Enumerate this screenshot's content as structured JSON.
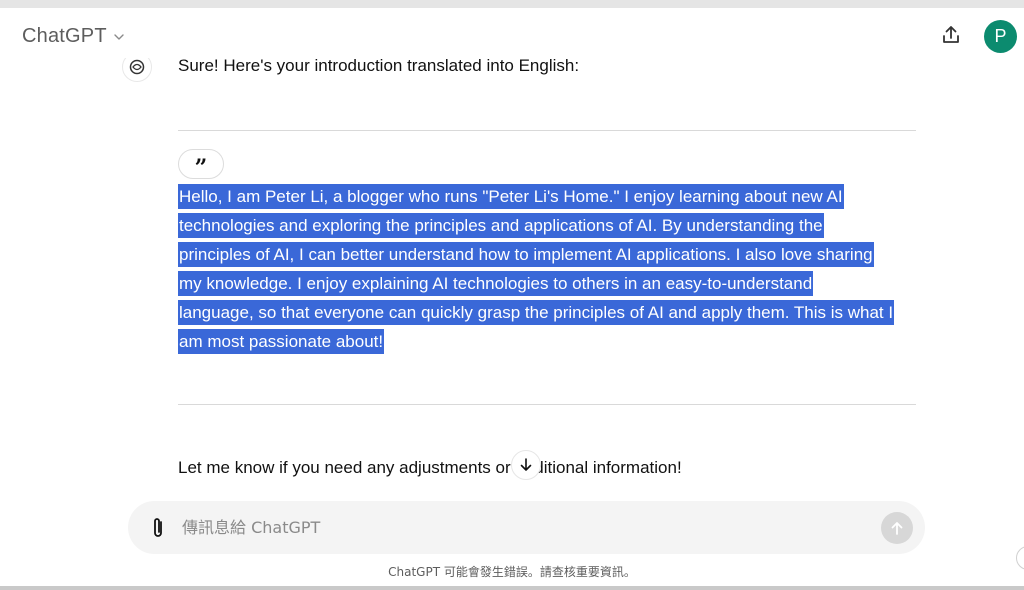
{
  "header": {
    "model_name": "ChatGPT",
    "avatar_letter": "P"
  },
  "conversation": {
    "intro_line": "Sure! Here's your introduction translated into English:",
    "quote_mark": "”",
    "quote_lines": [
      "Hello, I am Peter Li, a blogger who runs \"Peter Li's Home.\" I enjoy learning about new AI",
      "technologies and exploring the principles and applications of AI. By understanding the",
      "principles of AI, I can better understand how to implement AI applications. I also love sharing",
      "my knowledge. I enjoy explaining AI technologies to others in an easy-to-understand",
      "language, so that everyone can quickly grasp the principles of AI and apply them. This is what I",
      "am most passionate about!"
    ],
    "closing_line": "Let me know if you need any adjustments or additional information!"
  },
  "composer": {
    "placeholder": "傳訊息給 ChatGPT"
  },
  "footer": {
    "disclaimer": "ChatGPT 可能會發生錯誤。請查核重要資訊。"
  },
  "colors": {
    "highlight": "#3a68d8",
    "avatar": "#0c8b6f"
  },
  "icons": {
    "model_chevron": "chevron-down-icon",
    "share": "share-upload-icon",
    "assistant": "openai-logo-icon",
    "scroll": "arrow-down-icon",
    "attach": "paperclip-icon",
    "send": "arrow-up-icon"
  }
}
